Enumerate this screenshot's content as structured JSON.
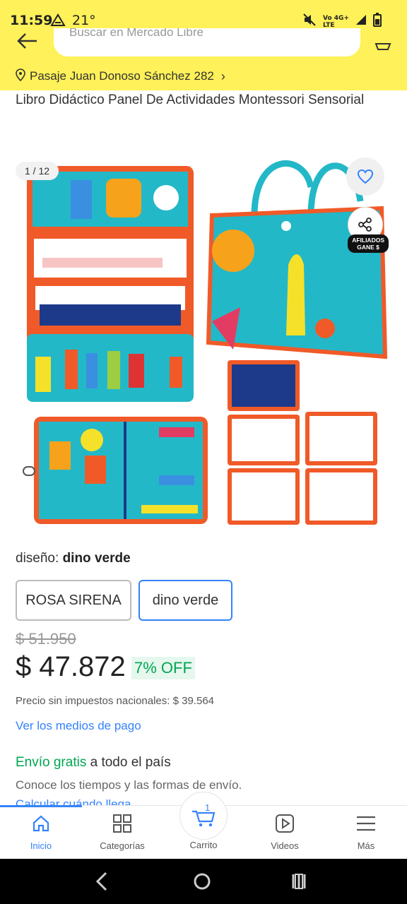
{
  "status_bar": {
    "time": "11:59",
    "temperature": "21°",
    "network_label_top": "Vo",
    "network_label_bottom": "LTE",
    "network_label_gen": "4G+"
  },
  "header": {
    "search_placeholder": "Buscar en Mercado Libre",
    "address": "Pasaje  Juan Donoso Sánchez 282"
  },
  "product": {
    "title": "Libro Didáctico Panel De Actividades Montessori Sensorial",
    "gallery_counter": "1 / 12",
    "affiliate_label_1": "AFILIADOS",
    "affiliate_label_2": "GANE $",
    "variant_label": "diseño:",
    "variant_selected": "dino verde",
    "variant_options": [
      "ROSA SIRENA",
      "dino verde"
    ],
    "old_price": "$ 51.950",
    "price": "$ 47.872",
    "discount": "7% OFF",
    "tax_note": "Precio sin impuestos nacionales: $ 39.564",
    "payment_link": "Ver los medios de pago",
    "shipping_free": "Envío gratis",
    "shipping_rest": " a todo el país",
    "shipping_sub": "Conoce los tiempos y las formas de envío.",
    "shipping_calc": "Calcular cuándo llega"
  },
  "bottom_nav": {
    "items": [
      "Inicio",
      "Categorías",
      "Carrito",
      "Videos",
      "Más"
    ],
    "cart_count": "1"
  },
  "colors": {
    "header_bg": "#fff159",
    "accent": "#3483fa",
    "success": "#00a650"
  }
}
